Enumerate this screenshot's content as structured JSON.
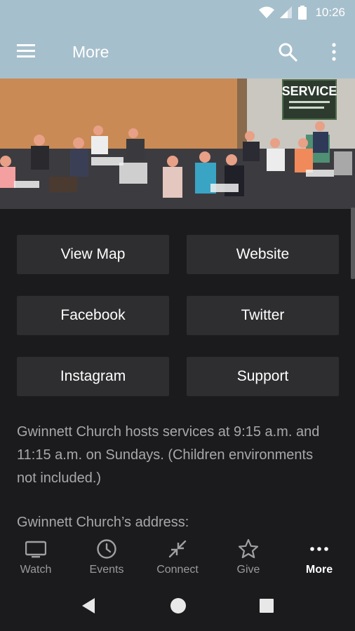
{
  "status_bar": {
    "time": "10:26"
  },
  "app_bar": {
    "title": "More"
  },
  "colors": {
    "header_bg": "#a6bfcc",
    "page_bg": "#1b1b1e",
    "button_bg": "#2e2e30",
    "muted_text": "#a8a8aa"
  },
  "hero": {
    "sign_text": "SERVICE"
  },
  "buttons": [
    {
      "label": "View Map"
    },
    {
      "label": "Website"
    },
    {
      "label": "Facebook"
    },
    {
      "label": "Twitter"
    },
    {
      "label": "Instagram"
    },
    {
      "label": "Support"
    }
  ],
  "info": {
    "services_text": "Gwinnett Church hosts services at 9:15 a.m. and 11:15 a.m. on Sundays.  (Children environments not included.)",
    "address_heading": "Gwinnett Church’s address:"
  },
  "bottom_nav": [
    {
      "label": "Watch",
      "icon": "tv-icon"
    },
    {
      "label": "Events",
      "icon": "clock-icon"
    },
    {
      "label": "Connect",
      "icon": "collapse-arrows-icon"
    },
    {
      "label": "Give",
      "icon": "star-icon"
    },
    {
      "label": "More",
      "icon": "more-dots-icon",
      "active": true
    }
  ]
}
